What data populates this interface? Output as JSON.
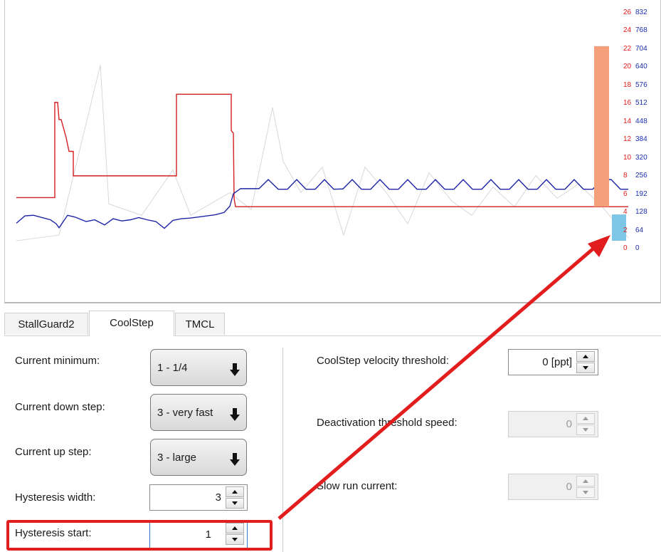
{
  "tabs": [
    "StallGuard2",
    "CoolStep",
    "TMCL"
  ],
  "active_tab": "CoolStep",
  "chart_data": {
    "type": "line",
    "title": "",
    "left_axis": {
      "color": "#e31a1a",
      "ticks": [
        0,
        2,
        4,
        6,
        8,
        10,
        12,
        14,
        16,
        18,
        20,
        22,
        24,
        26
      ]
    },
    "right_axis": {
      "color": "#1a2fb0",
      "ticks": [
        0,
        64,
        128,
        192,
        256,
        320,
        384,
        448,
        512,
        576,
        640,
        704,
        768,
        832
      ]
    },
    "series": [
      {
        "color": "#d42020",
        "axis": "left",
        "x": [
          0,
          54,
          54,
          58,
          60,
          63,
          70,
          70,
          74,
          80,
          80,
          225,
          225,
          302,
          302,
          305,
          306,
          308,
          860
        ],
        "y": [
          5.7,
          5.7,
          16.2,
          16.2,
          14.3,
          14.3,
          12.3,
          12.3,
          10.8,
          10.8,
          8.1,
          8.1,
          17.1,
          17.1,
          13.1,
          12.8,
          5.6,
          4.7,
          4.7
        ]
      },
      {
        "color": "#1f25a8",
        "axis": "right",
        "x": [
          0,
          12,
          24,
          36,
          48,
          56,
          60,
          72,
          82,
          98,
          110,
          124,
          136,
          148,
          160,
          172,
          184,
          196,
          208,
          220,
          232,
          244,
          256,
          268,
          280,
          292,
          300,
          305,
          315,
          328,
          341,
          354,
          368,
          381,
          394,
          407,
          420,
          433,
          446,
          459,
          472,
          485,
          498,
          511,
          524,
          537,
          550,
          563,
          576,
          589,
          602,
          615,
          628,
          641,
          654,
          667,
          680,
          693,
          706,
          719,
          732,
          745,
          758,
          771,
          784,
          797,
          810,
          823,
          836,
          849,
          860
        ],
        "y": [
          92,
          118,
          120,
          112,
          104,
          90,
          76,
          120,
          114,
          98,
          104,
          86,
          108,
          100,
          104,
          112,
          104,
          98,
          74,
          102,
          108,
          110,
          114,
          118,
          122,
          130,
          152,
          196,
          214,
          214,
          214,
          246,
          212,
          212,
          246,
          212,
          212,
          246,
          212,
          213,
          246,
          212,
          212,
          246,
          212,
          212,
          246,
          212,
          212,
          246,
          212,
          212,
          246,
          212,
          212,
          246,
          212,
          212,
          246,
          212,
          212,
          246,
          212,
          212,
          246,
          212,
          212,
          246,
          246,
          212,
          212
        ]
      },
      {
        "color": "#d8d8d8",
        "axis": "right",
        "x": [
          0,
          60,
          118,
          130,
          176,
          220,
          245,
          300,
          330,
          360,
          375,
          400,
          430,
          460,
          490,
          520,
          550,
          580,
          612,
          640,
          670,
          700,
          730,
          760,
          790,
          820,
          860
        ],
        "y": [
          30,
          50,
          650,
          160,
          120,
          280,
          120,
          200,
          140,
          500,
          310,
          200,
          290,
          50,
          290,
          200,
          90,
          270,
          170,
          120,
          220,
          150,
          260,
          180,
          230,
          160,
          40
        ]
      }
    ],
    "bars": [
      {
        "axis": "left",
        "value": 22.4,
        "color": "#f4a07a"
      },
      {
        "axis": "right",
        "value": 128,
        "color": "#7ec6e6"
      }
    ]
  },
  "left_panel": {
    "current_minimum": {
      "label": "Current minimum:",
      "value": "1 - 1/4"
    },
    "current_down_step": {
      "label": "Current down step:",
      "value": "3 - very fast"
    },
    "current_up_step": {
      "label": "Current up step:",
      "value": "3 - large"
    },
    "hysteresis_width": {
      "label": "Hysteresis width:",
      "value": "3"
    },
    "hysteresis_start": {
      "label": "Hysteresis start:",
      "value": "1"
    }
  },
  "right_panel": {
    "coolstep_velocity_threshold": {
      "label": "CoolStep velocity threshold:",
      "value": "0 [ppt]"
    },
    "deactivation_threshold_speed": {
      "label": "Deactivation threshold speed:",
      "value": "0"
    },
    "slow_run_current": {
      "label": "Slow run current:",
      "value": "0"
    }
  },
  "annotation": {
    "color": "#e21d1d"
  }
}
